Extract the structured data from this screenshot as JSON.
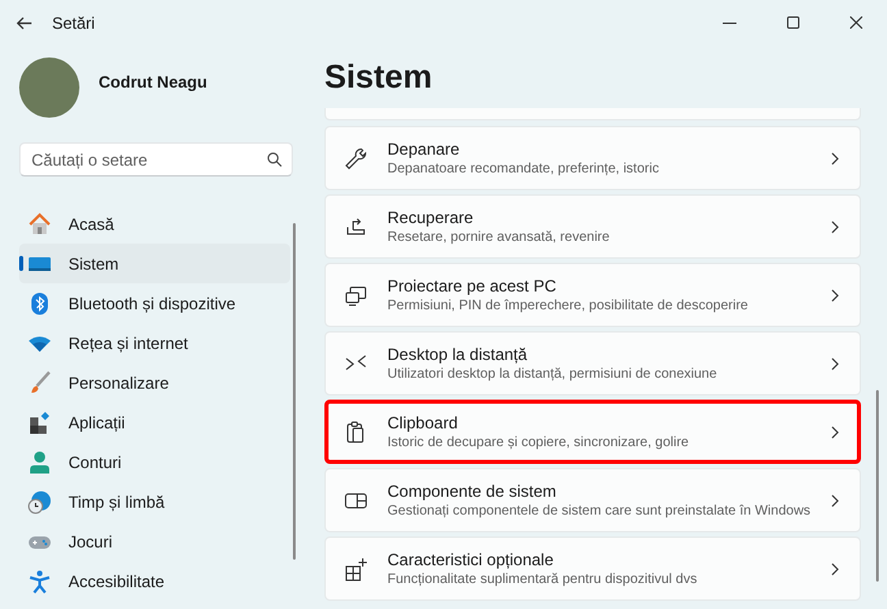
{
  "window": {
    "title": "Setări"
  },
  "profile": {
    "name": "Codrut Neagu"
  },
  "search": {
    "placeholder": "Căutați o setare"
  },
  "sidebar": {
    "items": [
      {
        "label": "Acasă",
        "selected": false
      },
      {
        "label": "Sistem",
        "selected": true
      },
      {
        "label": "Bluetooth și dispozitive",
        "selected": false
      },
      {
        "label": "Rețea și internet",
        "selected": false
      },
      {
        "label": "Personalizare",
        "selected": false
      },
      {
        "label": "Aplicații",
        "selected": false
      },
      {
        "label": "Conturi",
        "selected": false
      },
      {
        "label": "Timp și limbă",
        "selected": false
      },
      {
        "label": "Jocuri",
        "selected": false
      },
      {
        "label": "Accesibilitate",
        "selected": false
      }
    ]
  },
  "page": {
    "title": "Sistem",
    "cards": [
      {
        "title": "Depanare",
        "subtitle": "Depanatoare recomandate, preferințe, istoric",
        "highlighted": false
      },
      {
        "title": "Recuperare",
        "subtitle": "Resetare, pornire avansată, revenire",
        "highlighted": false
      },
      {
        "title": "Proiectare pe acest PC",
        "subtitle": "Permisiuni, PIN de împerechere, posibilitate de descoperire",
        "highlighted": false
      },
      {
        "title": "Desktop la distanță",
        "subtitle": "Utilizatori desktop la distanță, permisiuni de conexiune",
        "highlighted": false
      },
      {
        "title": "Clipboard",
        "subtitle": "Istoric de decupare și copiere, sincronizare, golire",
        "highlighted": true
      },
      {
        "title": "Componente de sistem",
        "subtitle": "Gestionați componentele de sistem care sunt preinstalate în Windows",
        "highlighted": false
      },
      {
        "title": "Caracteristici opționale",
        "subtitle": "Funcționalitate suplimentară pentru dispozitivul dvs",
        "highlighted": false
      }
    ]
  }
}
